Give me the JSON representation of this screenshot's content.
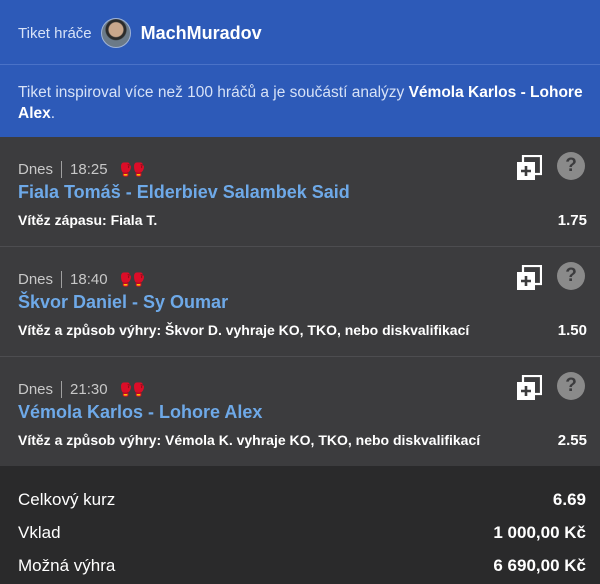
{
  "header": {
    "label": "Tiket hráče",
    "username": "MachMuradov",
    "info_prefix": "Tiket inspiroval více než 100 hráčů a je součástí analýzy ",
    "info_link": "Vémola Karlos - Lohore Alex",
    "info_suffix": "."
  },
  "bets": [
    {
      "day": "Dnes",
      "time": "18:25",
      "match": "Fiala Tomáš - Elderbiev Salambek Said",
      "market": "Vítěz zápasu: Fiala T.",
      "odds": "1.75"
    },
    {
      "day": "Dnes",
      "time": "18:40",
      "match": "Škvor Daniel - Sy Oumar",
      "market": "Vítěz a způsob výhry: Škvor D. vyhraje KO, TKO, nebo diskvalifikací",
      "odds": "1.50"
    },
    {
      "day": "Dnes",
      "time": "21:30",
      "match": "Vémola Karlos - Lohore Alex",
      "market": "Vítěz a způsob výhry: Vémola K. vyhraje KO, TKO, nebo diskvalifikací",
      "odds": "2.55"
    }
  ],
  "summary": {
    "total_odds_label": "Celkový kurz",
    "total_odds_value": "6.69",
    "stake_label": "Vklad",
    "stake_value": "1 000,00 Kč",
    "win_label": "Možná výhra",
    "win_value": "6 690,00 Kč"
  },
  "icons": {
    "copy": "copy-icon",
    "help": "help-icon",
    "sport": "boxing-gloves-icon"
  },
  "colors": {
    "header_bg": "#2d5ab8",
    "match_link": "#6ea9e8",
    "panel_bg": "#3c3c3e",
    "summary_bg": "#2a2a2b"
  }
}
